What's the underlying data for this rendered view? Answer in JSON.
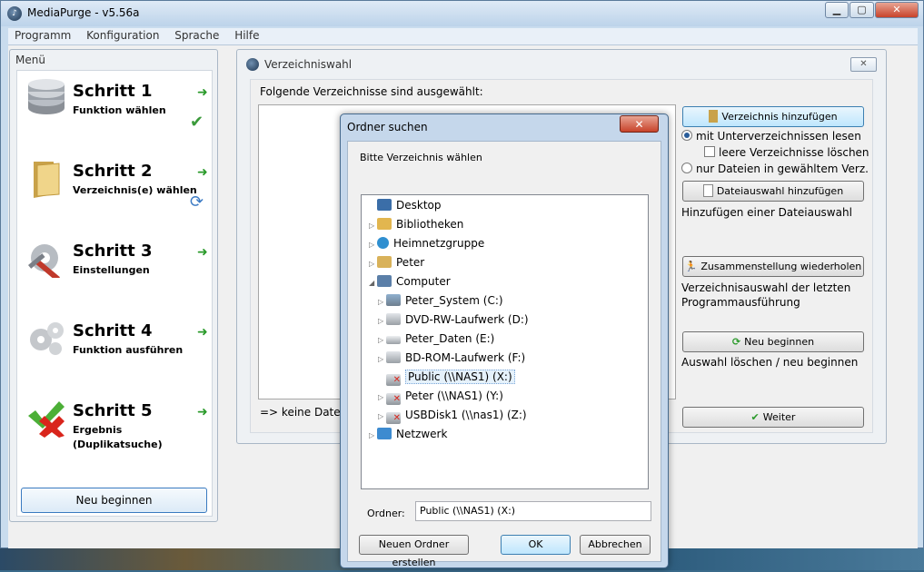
{
  "app": {
    "title": "MediaPurge - v5.56a",
    "icon": "app-logo-icon"
  },
  "window_controls": {
    "minimize": "▁",
    "maximize": "▢",
    "close": "✕"
  },
  "menu": [
    "Programm",
    "Konfiguration",
    "Sprache",
    "Hilfe"
  ],
  "sidebar": {
    "title": "Menü",
    "steps": [
      {
        "title": "Schritt 1",
        "subtitle": "Funktion wählen",
        "icon": "database-icon",
        "state": "done"
      },
      {
        "title": "Schritt 2",
        "subtitle": "Verzeichnis(e) wählen",
        "icon": "folder-icon",
        "state": "active"
      },
      {
        "title": "Schritt 3",
        "subtitle": "Einstellungen",
        "icon": "tools-icon",
        "state": ""
      },
      {
        "title": "Schritt 4",
        "subtitle": "Funktion ausführen",
        "icon": "gears-icon",
        "state": ""
      },
      {
        "title": "Schritt 5",
        "subtitle": "Ergebnis",
        "subtitle2": "(Duplikatsuche)",
        "icon": "check-cross-icon",
        "state": ""
      }
    ],
    "new_button": "Neu beginnen"
  },
  "panel": {
    "title": "Verzeichniswahl",
    "close": "✕",
    "heading": "Folgende Verzeichnisse sind ausgewählt:",
    "status": "=> keine Dateien",
    "add_dir_button": "Verzeichnis hinzufügen",
    "option_subdirs": "mit Unterverzeichnissen lesen",
    "option_empty": "leere Verzeichnisse löschen",
    "option_files_only": "nur Dateien in gewähltem Verz.",
    "add_files_button": "Dateiauswahl hinzufügen",
    "add_files_desc": "Hinzufügen einer Dateiauswahl",
    "restore_button": "Zusammenstellung wiederholen",
    "restore_desc_1": "Verzeichnisauswahl der letzten",
    "restore_desc_2": "Programmausführung",
    "restart_button": "Neu beginnen",
    "restart_desc": "Auswahl löschen / neu beginnen",
    "next_button": "Weiter"
  },
  "dialog": {
    "title": "Ordner suchen",
    "close": "✕",
    "prompt": "Bitte Verzeichnis wählen",
    "tree": [
      {
        "label": "Desktop",
        "icon": "desktop-icon",
        "level": 0,
        "twisty": ""
      },
      {
        "label": "Bibliotheken",
        "icon": "libraries-icon",
        "level": 1,
        "twisty": "▷"
      },
      {
        "label": "Heimnetzgruppe",
        "icon": "homegroup-icon",
        "level": 1,
        "twisty": "▷"
      },
      {
        "label": "Peter",
        "icon": "user-folder-icon",
        "level": 1,
        "twisty": "▷"
      },
      {
        "label": "Computer",
        "icon": "computer-icon",
        "level": 1,
        "twisty": "◢"
      },
      {
        "label": "Peter_System (C:)",
        "icon": "system-drive-icon",
        "level": 2,
        "twisty": "▷"
      },
      {
        "label": "DVD-RW-Laufwerk (D:)",
        "icon": "dvd-drive-icon",
        "level": 2,
        "twisty": "▷"
      },
      {
        "label": "Peter_Daten (E:)",
        "icon": "hard-drive-icon",
        "level": 2,
        "twisty": "▷"
      },
      {
        "label": "BD-ROM-Laufwerk (F:)",
        "icon": "bd-drive-icon",
        "level": 2,
        "twisty": "▷"
      },
      {
        "label": "Public (\\\\NAS1) (X:)",
        "icon": "network-drive-disconnected-icon",
        "level": 2,
        "twisty": "",
        "selected": true
      },
      {
        "label": "Peter (\\\\NAS1) (Y:)",
        "icon": "network-drive-disconnected-icon",
        "level": 2,
        "twisty": "▷"
      },
      {
        "label": "USBDisk1 (\\\\nas1) (Z:)",
        "icon": "network-drive-disconnected-icon",
        "level": 2,
        "twisty": "▷"
      },
      {
        "label": "Netzwerk",
        "icon": "network-icon",
        "level": 1,
        "twisty": "▷"
      }
    ],
    "folder_label": "Ordner:",
    "folder_value": "Public (\\\\NAS1) (X:)",
    "new_folder_button": "Neuen Ordner erstellen",
    "ok_button": "OK",
    "cancel_button": "Abbrechen"
  }
}
